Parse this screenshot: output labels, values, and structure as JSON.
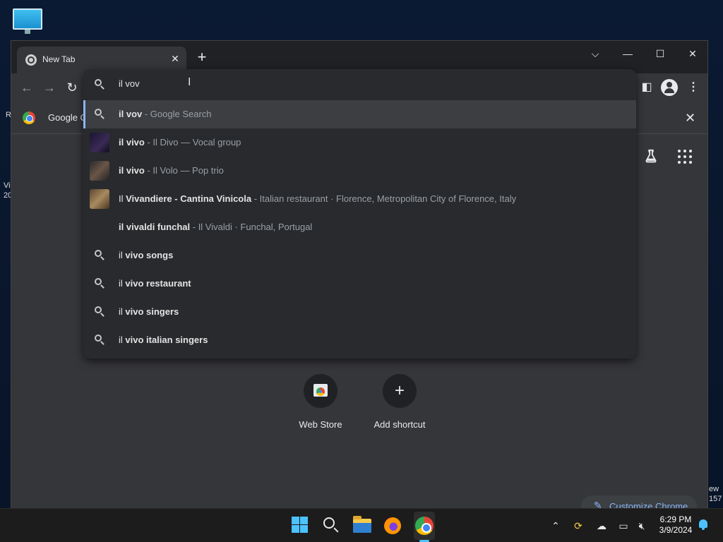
{
  "desktop": {
    "left_text_1": "Vi",
    "left_text_2": "20",
    "r_text": "R",
    "right_text_1": "ew",
    "right_text_2": "157"
  },
  "browser": {
    "tab_title": "New Tab",
    "infobar_text": "Google C",
    "omnibox": {
      "input_value": "il vov",
      "suggestions": [
        {
          "main_bold": "il vov",
          "main_rest": "",
          "sub": " - Google Search",
          "kind": "search"
        },
        {
          "main_bold": "il vivo",
          "main_rest": "",
          "sub": " - Il Divo — Vocal group",
          "kind": "entity"
        },
        {
          "main_bold": "il vivo",
          "main_rest": "",
          "sub": " - Il Volo — Pop trio",
          "kind": "entity"
        },
        {
          "main_pre": "Il ",
          "main_bold": "Vivandiere - Cantina Vinicola",
          "main_rest": "",
          "sub": " - Italian restaurant · Florence, Metropolitan City of Florence, Italy",
          "kind": "place"
        },
        {
          "main_bold": "il vivaldi funchal",
          "main_rest": "",
          "sub": " - Il Vivaldi · Funchal, Portugal",
          "kind": "none"
        },
        {
          "main_pre": "il ",
          "main_bold": "vivo songs",
          "kind": "search"
        },
        {
          "main_pre": "il ",
          "main_bold": "vivo restaurant",
          "kind": "search"
        },
        {
          "main_pre": "il ",
          "main_bold": "vivo singers",
          "kind": "search"
        },
        {
          "main_pre": "il ",
          "main_bold": "vivo italian singers",
          "kind": "search"
        }
      ]
    },
    "shortcuts": [
      {
        "label": "Web Store"
      },
      {
        "label": "Add shortcut"
      }
    ],
    "customize_label": "Customize Chrome"
  },
  "taskbar": {
    "time": "6:29 PM",
    "date": "3/9/2024",
    "accent": "#4cc2ff"
  }
}
